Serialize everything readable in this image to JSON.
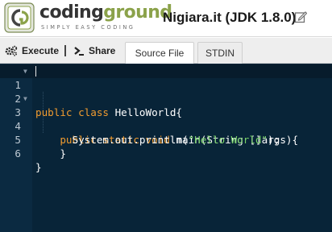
{
  "header": {
    "brand_part1": "coding",
    "brand_part2": "ground",
    "tagline": "SIMPLY EASY CODING",
    "project_title": "Nigiara.it (JDK 1.8.0)",
    "logo_icon": "cg-logo-icon",
    "edit_icon": "edit-icon"
  },
  "toolbar": {
    "execute_label": "Execute",
    "share_label": "Share",
    "tabs": [
      {
        "label": "Source File",
        "active": true
      },
      {
        "label": "STDIN",
        "active": false
      }
    ]
  },
  "editor": {
    "active_line": 1,
    "line_numbers": [
      "1",
      "2",
      "3",
      "4",
      "5",
      "6"
    ],
    "lines": [
      {
        "text": "public class HelloWorld{"
      },
      {
        "text": ""
      },
      {
        "text": "    public static void main(String []args){"
      },
      {
        "text": "      System.out.println(\"Hello World\");"
      },
      {
        "text": "    }"
      },
      {
        "text": "}"
      }
    ],
    "fold_lines": [
      1,
      3
    ]
  },
  "colors": {
    "editor_background": "#082438",
    "keyword": "#f29c2f",
    "string": "#79d26a",
    "brand_green": "#8ba24a"
  }
}
